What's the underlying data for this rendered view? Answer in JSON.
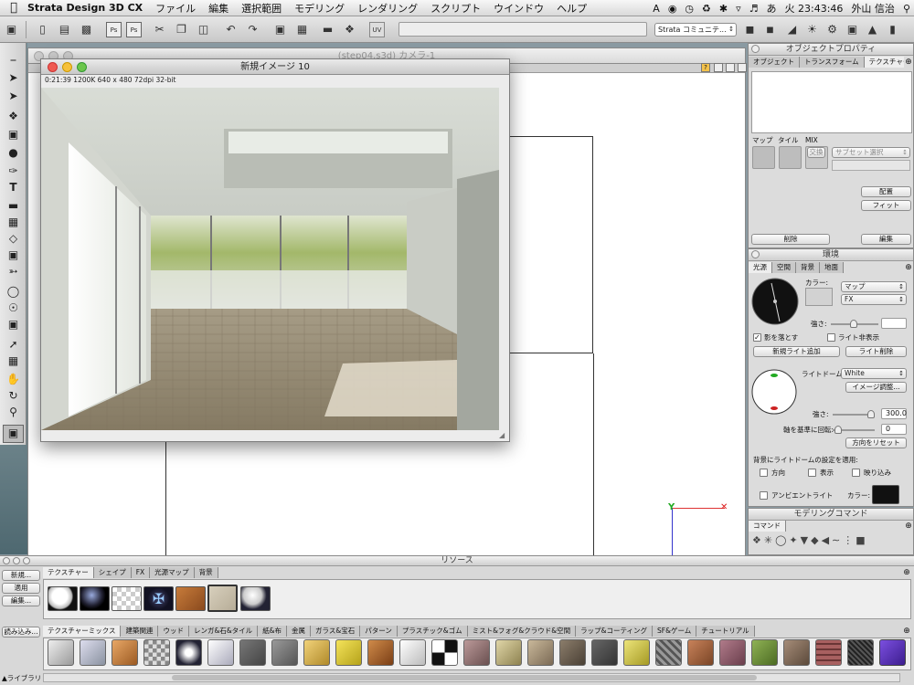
{
  "menubar": {
    "app_name": "Strata Design 3D CX",
    "items": [
      "ファイル",
      "編集",
      "選択範囲",
      "モデリング",
      "レンダリング",
      "スクリプト",
      "ウインドウ",
      "ヘルプ"
    ],
    "clock": "火 23:43:46",
    "user": "外山 信治"
  },
  "toolbar": {
    "community_dropdown": "Strata コミュニテ..."
  },
  "model_window": {
    "title": "(step04.s3d) カメラ-1"
  },
  "render_window": {
    "title": "新規イメージ 10",
    "info": "0:21:39  1200K  640 x 480  72dpi  32-bit"
  },
  "object_properties": {
    "title": "オブジェクトプロパティ",
    "tabs": [
      "オブジェクト",
      "トランスフォーム",
      "テクスチャー"
    ],
    "active_tab": 2,
    "map_label": "マップ",
    "tile_label": "タイル",
    "mix_label": "MIX",
    "exchange_label": "交換",
    "subset_placeholder": "サブセット選択",
    "place_button": "配置",
    "fit_button": "フィット",
    "delete_button": "削除",
    "edit_button": "編集"
  },
  "environment": {
    "title": "環境",
    "tabs": [
      "光源",
      "空間",
      "背景",
      "地面"
    ],
    "active_tab": 0,
    "color_label": "カラー:",
    "map_select": "マップ",
    "fx_select": "FX",
    "strength_label": "強さ:",
    "cast_shadow_label": "影を落とす",
    "hide_light_label": "ライト非表示",
    "add_light_button": "新規ライト追加",
    "delete_light_button": "ライト削除",
    "light_dome_label": "ライトドーム:",
    "light_dome_value": "White",
    "image_adjust_button": "イメージ調整...",
    "dome_strength_label": "強さ:",
    "dome_strength_value": "300.0",
    "rotate_label": "軸を基準に回転:",
    "rotate_value": "0",
    "reset_direction_button": "方向をリセット",
    "apply_label": "背景にライトドームの設定を適用:",
    "direction_label": "方向",
    "display_label": "表示",
    "reflection_label": "映り込み",
    "ambient_label": "アンビエントライト",
    "ambient_color_label": "カラー:"
  },
  "modeling_commands": {
    "title": "モデリングコマンド",
    "tab": "コマンド"
  },
  "resources": {
    "title": "リソース",
    "tabs": [
      "テクスチャー",
      "シェイプ",
      "FX",
      "光源マップ",
      "背景"
    ],
    "active_tab": 0,
    "new_button": "新規...",
    "apply_button": "適用",
    "edit_button": "編集...",
    "load_button": "読み込み...",
    "library_label": "ライブラリ",
    "library_tabs": [
      "テクスチャーミックス",
      "建築関連",
      "ウッド",
      "レンガ&石&タイル",
      "紙&布",
      "金属",
      "ガラス&宝石",
      "パターン",
      "プラスチック&ゴム",
      "ミスト&フォグ&クラウド&空間",
      "ラップ&コーティング",
      "SF&ゲーム",
      "チュートリアル"
    ],
    "library_active_tab": 0
  },
  "colors": {
    "ambient_swatch": "#111111",
    "library_accent": "#7b4fe0"
  }
}
